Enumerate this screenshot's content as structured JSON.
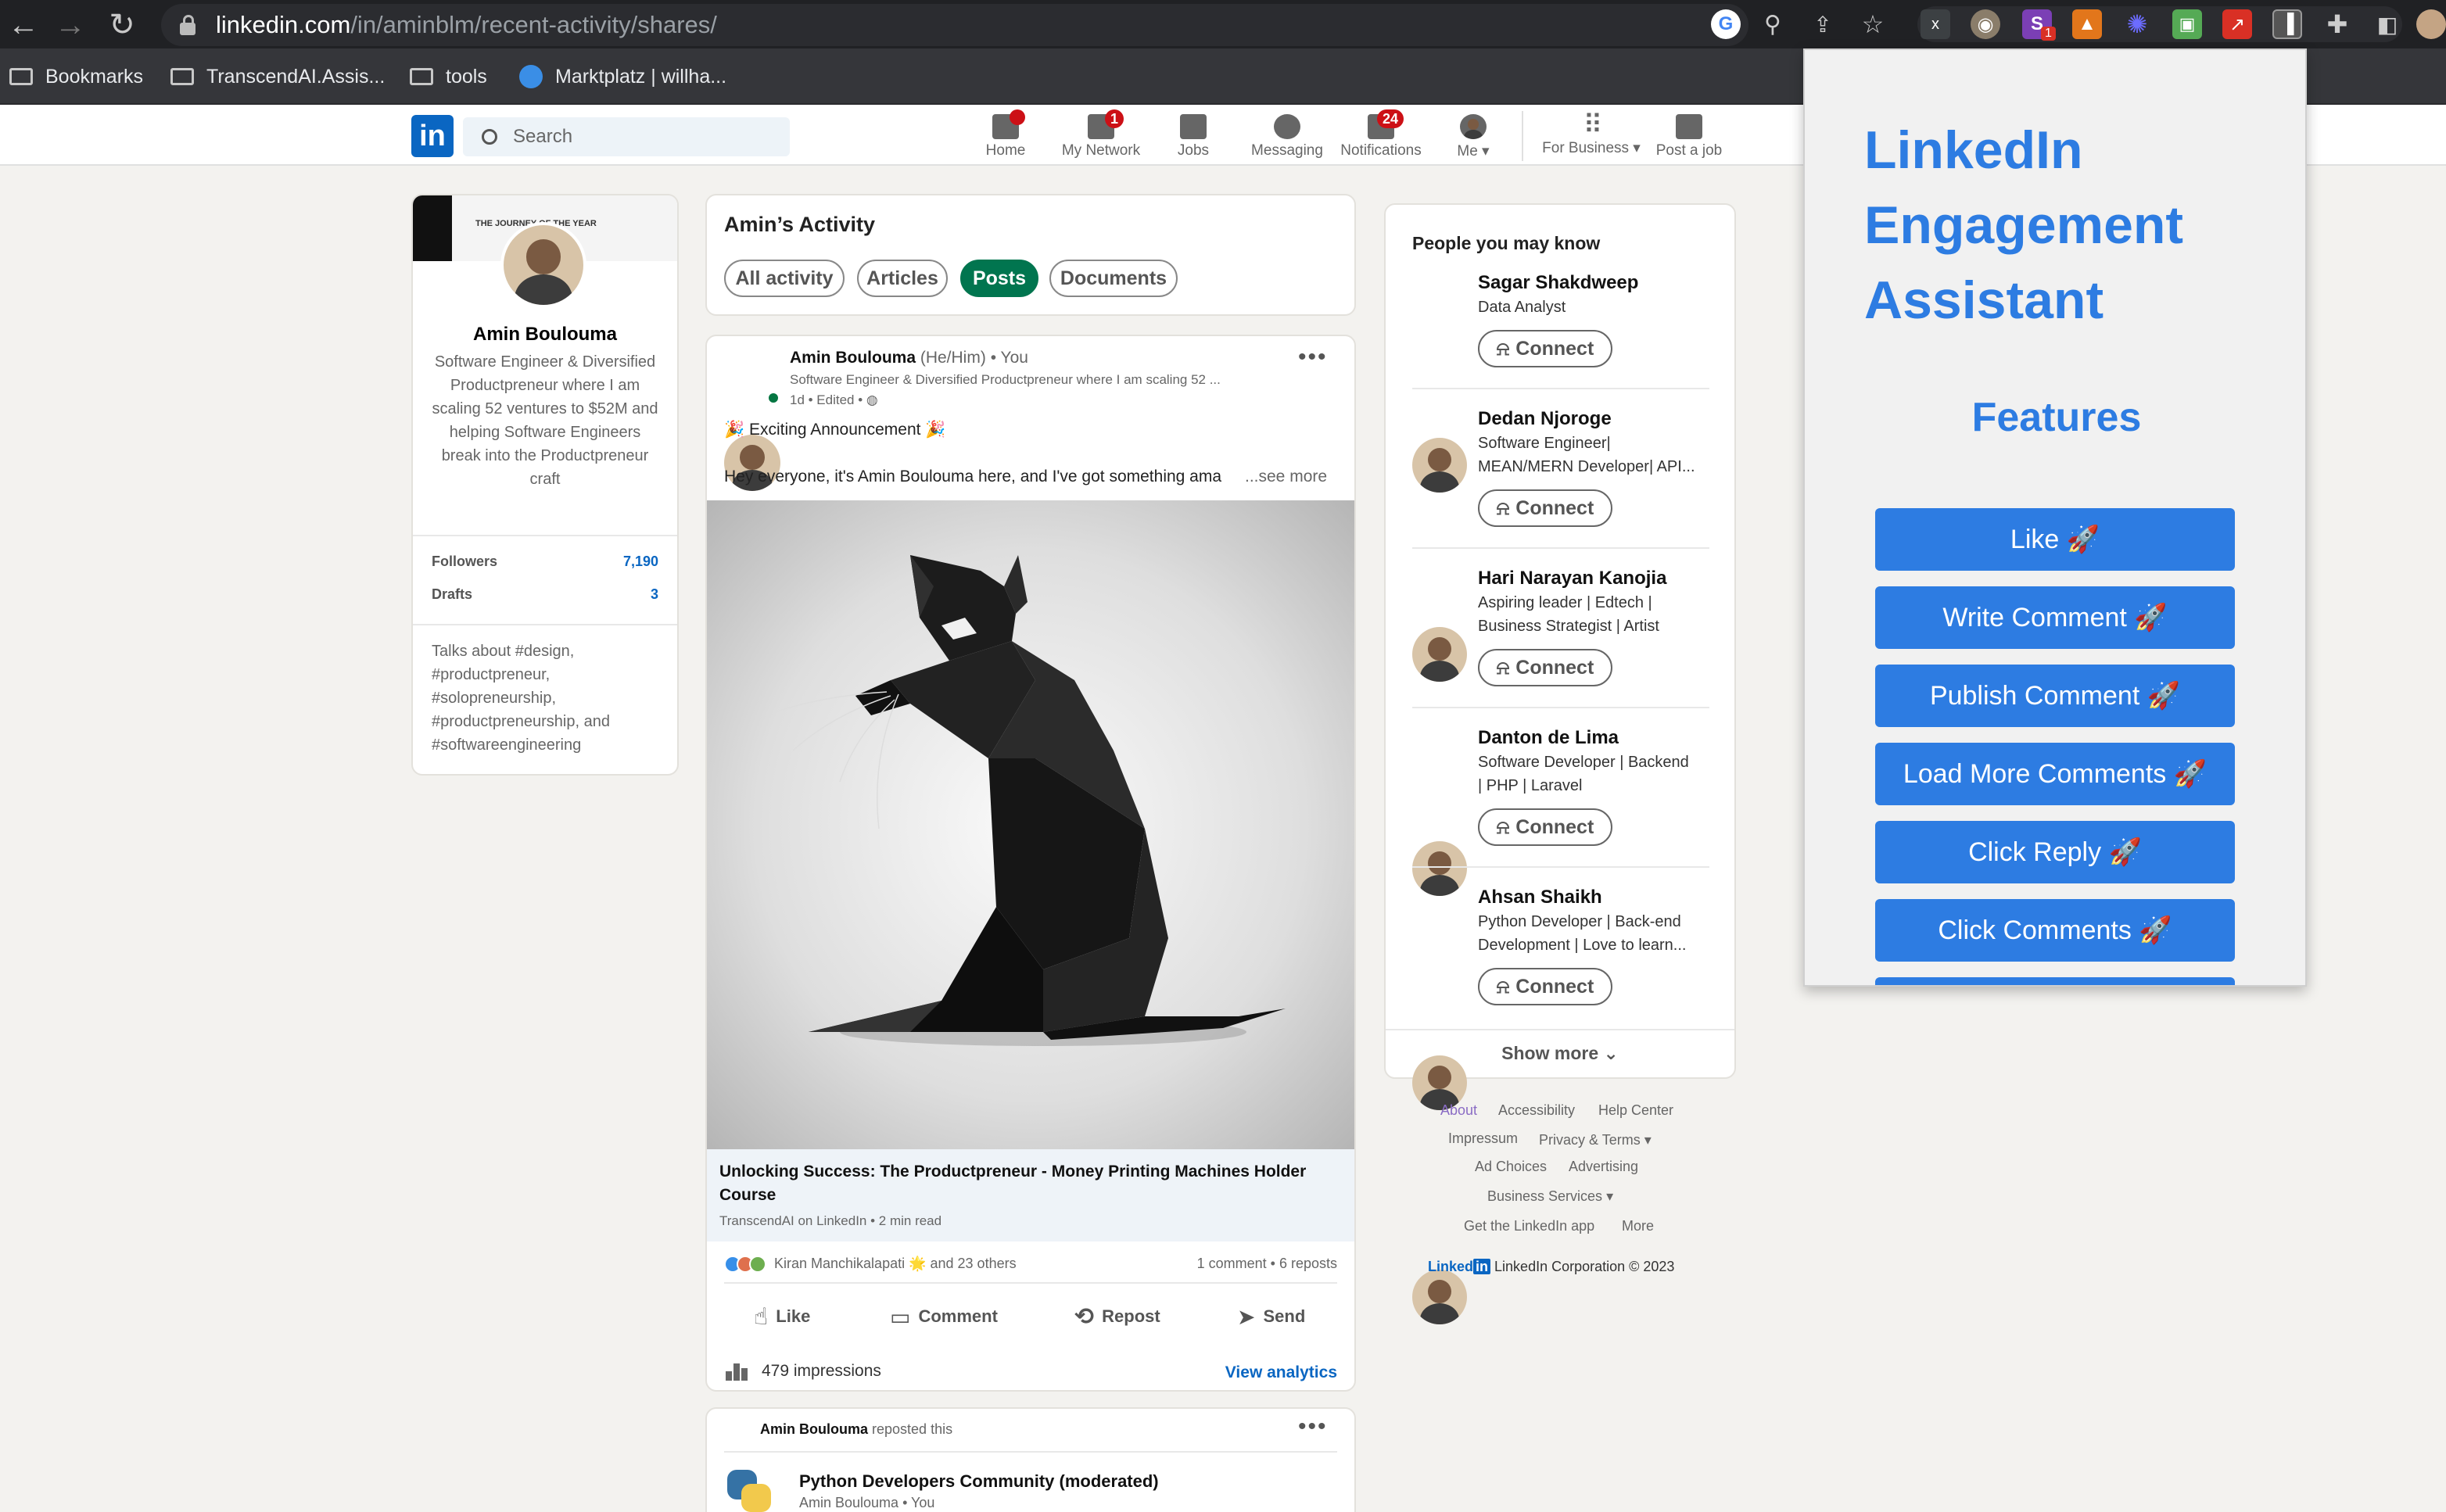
{
  "browser": {
    "url_host": "linkedin.com",
    "url_path": "/in/aminblm/recent-activity/shares/",
    "extension_badge": "1",
    "bookmarks": [
      {
        "label": "Bookmarks"
      },
      {
        "label": "TranscendAI.Assis..."
      },
      {
        "label": "tools"
      },
      {
        "label": "Marktplatz | willha..."
      }
    ]
  },
  "nav": {
    "search_placeholder": "Search",
    "items": [
      {
        "label": "Home",
        "badge": ""
      },
      {
        "label": "My Network",
        "badge": "1"
      },
      {
        "label": "Jobs",
        "badge": ""
      },
      {
        "label": "Messaging",
        "badge": ""
      },
      {
        "label": "Notifications",
        "badge": "24"
      },
      {
        "label": "Me",
        "badge": ""
      },
      {
        "label": "For Business",
        "badge": ""
      },
      {
        "label": "Post a job",
        "badge": ""
      }
    ],
    "logo_text": "in"
  },
  "profile": {
    "name": "Amin Boulouma",
    "headline": "Software Engineer & Diversified Productpreneur where I am scaling 52 ventures to $52M and helping Software Engineers break into the Productpreneur craft",
    "banner_text": "THE JOURNEY OF THE YEAR",
    "followers_label": "Followers",
    "followers_value": "7,190",
    "drafts_label": "Drafts",
    "drafts_value": "3",
    "talks_about": "Talks about #design, #productpreneur, #solopreneurship, #productpreneurship, and #softwareengineering"
  },
  "activity": {
    "title": "Amin’s Activity",
    "filters": [
      "All activity",
      "Articles",
      "Posts",
      "Documents"
    ],
    "active_filter": "Posts"
  },
  "post": {
    "author": "Amin Boulouma",
    "pronouns": "(He/Him)",
    "you": "• You",
    "author_headline": "Software Engineer & Diversified Productpreneur where I am scaling 52 ...",
    "meta": "1d • Edited •",
    "announcement": "🎉 Exciting Announcement 🎉",
    "body": "Hey everyone, it's Amin Boulouma here, and I've got something ama",
    "see_more": "...see more",
    "article_title": "Unlocking Success: The Productpreneur - Money Printing Machines Holder Course",
    "article_source": "TranscendAI on LinkedIn • 2 min read",
    "reactions": "Kiran Manchikalapati 🌟  and 23 others",
    "stats": "1 comment • 6 reposts",
    "actions": [
      "Like",
      "Comment",
      "Repost",
      "Send"
    ],
    "impressions": "479 impressions",
    "view_analytics": "View analytics"
  },
  "repost": {
    "author": "Amin Boulouma",
    "action": "reposted this",
    "group": "Python Developers Community (moderated)",
    "sub": "Amin Boulouma • You"
  },
  "pymk": {
    "title": "People you may know",
    "connect_label": "Connect",
    "people": [
      {
        "name": "Sagar Shakdweep",
        "line1": "Data Analyst",
        "line2": ""
      },
      {
        "name": "Dedan Njoroge",
        "line1": "Software Engineer|",
        "line2": "MEAN/MERN Developer| API..."
      },
      {
        "name": "Hari Narayan Kanojia",
        "line1": "Aspiring leader | Edtech |",
        "line2": "Business Strategist | Artist"
      },
      {
        "name": "Danton de Lima",
        "line1": "Software Developer | Backend",
        "line2": "| PHP | Laravel"
      },
      {
        "name": "Ahsan Shaikh",
        "line1": "Python Developer | Back-end",
        "line2": "Development | Love to learn..."
      }
    ],
    "show_more": "Show more"
  },
  "footer": {
    "links": [
      "About",
      "Accessibility",
      "Help Center",
      "Impressum",
      "Privacy & Terms",
      "Ad Choices",
      "Advertising",
      "Business Services",
      "Get the LinkedIn app",
      "More"
    ],
    "brand": "Linked",
    "brand_in": "in",
    "copyright": "LinkedIn Corporation © 2023"
  },
  "extension": {
    "title": "LinkedIn Engagement Assistant",
    "features_heading": "Features",
    "buttons": [
      "Like 🚀",
      "Write Comment 🚀",
      "Publish Comment 🚀",
      "Load More Comments 🚀",
      "Click Reply 🚀",
      "Click Comments 🚀"
    ]
  },
  "icons": {
    "accent": "#0a66c2",
    "extension_accent": "#2d7ce2",
    "active_filter_bg": "#01754f"
  }
}
